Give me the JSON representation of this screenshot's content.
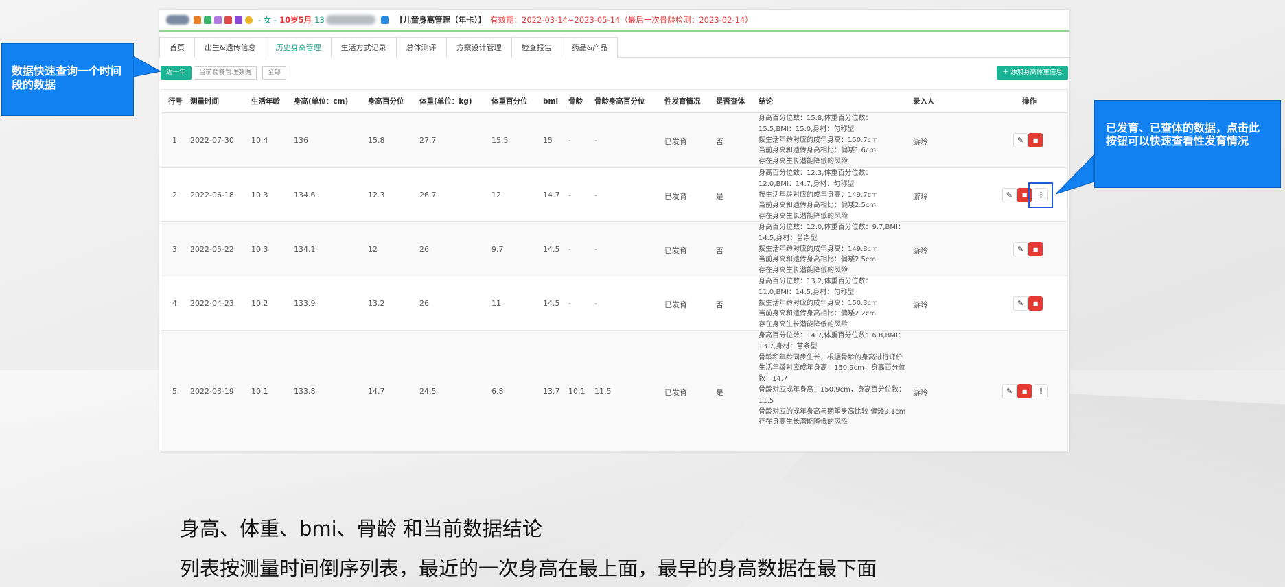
{
  "patient": {
    "gender": "女",
    "age": "10岁5月",
    "id_prefix": "13",
    "program": "【儿童身高管理（年卡）】",
    "valid_period": "有效期：2022-03-14~2023-05-14（最后一次骨龄检测：2023-02-14）"
  },
  "tabs": [
    "首页",
    "出生&遗传信息",
    "历史身高管理",
    "生活方式记录",
    "总体测评",
    "方案设计管理",
    "检查报告",
    "药品&产品"
  ],
  "active_tab": "历史身高管理",
  "filters": {
    "recent_year": "近一年",
    "current_package": "当前套餐管理数据",
    "all": "全部"
  },
  "add_button": "＋ 添加身高体重信息",
  "table": {
    "columns": [
      "行号",
      "测量时间",
      "生活年龄",
      "身高(单位：cm)",
      "身高百分位",
      "体重(单位：kg)",
      "体重百分位",
      "bmi",
      "骨龄",
      "骨龄身高百分位",
      "性发育情况",
      "是否查体",
      "结论",
      "录入人",
      "操作"
    ],
    "rows": [
      {
        "no": "1",
        "date": "2022-07-30",
        "age": "10.4",
        "height": "136",
        "h_pct": "15.8",
        "weight": "27.7",
        "w_pct": "15.5",
        "bmi": "15",
        "bone_age": "-",
        "bone_h_pct": "-",
        "sex_dev": "已发育",
        "exam": "否",
        "conclusion": [
          "身高百分位数：15.8,体重百分位数：15.5,BMI：15.0,身材：匀称型",
          "按生活年龄对应的成年身高：150.7cm",
          "当前身高和遗传身高相比：偏矮1.6cm",
          "存在身高生长潜能降低的风险"
        ],
        "entered_by": "游玲"
      },
      {
        "no": "2",
        "date": "2022-06-18",
        "age": "10.3",
        "height": "134.6",
        "h_pct": "12.3",
        "weight": "26.7",
        "w_pct": "12",
        "bmi": "14.7",
        "bone_age": "-",
        "bone_h_pct": "-",
        "sex_dev": "已发育",
        "exam": "是",
        "conclusion": [
          "身高百分位数：12.3,体重百分位数：12.0,BMI：14.7,身材：匀称型",
          "按生活年龄对应的成年身高：149.7cm",
          "当前身高和遗传身高相比：偏矮2.5cm",
          "存在身高生长潜能降低的风险"
        ],
        "entered_by": "游玲"
      },
      {
        "no": "3",
        "date": "2022-05-22",
        "age": "10.3",
        "height": "134.1",
        "h_pct": "12",
        "weight": "26",
        "w_pct": "9.7",
        "bmi": "14.5",
        "bone_age": "-",
        "bone_h_pct": "-",
        "sex_dev": "已发育",
        "exam": "否",
        "conclusion": [
          "身高百分位数：12.0,体重百分位数：9.7,BMI：14.5,身材：苗条型",
          "按生活年龄对应的成年身高：149.8cm",
          "当前身高和遗传身高相比：偏矮2.5cm",
          "存在身高生长潜能降低的风险"
        ],
        "entered_by": "游玲"
      },
      {
        "no": "4",
        "date": "2022-04-23",
        "age": "10.2",
        "height": "133.9",
        "h_pct": "13.2",
        "weight": "26",
        "w_pct": "11",
        "bmi": "14.5",
        "bone_age": "-",
        "bone_h_pct": "-",
        "sex_dev": "已发育",
        "exam": "否",
        "conclusion": [
          "身高百分位数：13.2,体重百分位数：11.0,BMI：14.5,身材：匀称型",
          "按生活年龄对应的成年身高：150.3cm",
          "当前身高和遗传身高相比：偏矮2.2cm",
          "存在身高生长潜能降低的风险"
        ],
        "entered_by": "游玲"
      },
      {
        "no": "5",
        "date": "2022-03-19",
        "age": "10.1",
        "height": "133.8",
        "h_pct": "14.7",
        "weight": "24.5",
        "w_pct": "6.8",
        "bmi": "13.7",
        "bone_age": "10.1",
        "bone_h_pct": "11.5",
        "sex_dev": "已发育",
        "exam": "是",
        "conclusion": [
          "身高百分位数：14.7,体重百分位数：6.8,BMI：13.7,身材：苗条型",
          "骨龄和年龄同步生长，根据骨龄的身高进行评价",
          "生活年龄对应成年身高：150.9cm，身高百分位数：14.7",
          "骨龄对应成年身高：150.9cm，身高百分位数：11.5",
          "骨龄对应的成年身高与期望身高比较 偏矮9.1cm",
          "存在身高生长潜能降低的风险"
        ],
        "entered_by": "游玲"
      }
    ]
  },
  "callouts": {
    "left": "数据快速查询一个时间段的数据",
    "right": "已发育、已查体的数据，点击此按钮可以快速查看性发育情况"
  },
  "captions": {
    "line1": "身高、体重、bmi、骨龄 和当前数据结论",
    "line2": "列表按测量时间倒序列表，最近的一次身高在最上面，最早的身高数据在最下面"
  },
  "icons": {
    "edit": "pencil-icon",
    "delete": "trash-icon",
    "more": "more-vertical-icon"
  },
  "colors": {
    "accent": "#1ab394",
    "danger": "#e53a34",
    "callout": "#1180f0",
    "alert_text": "#e03a3a"
  }
}
